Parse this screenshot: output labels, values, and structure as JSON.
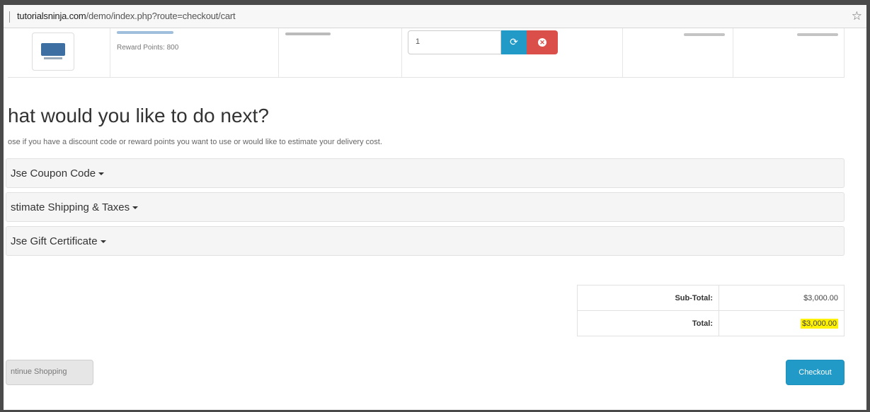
{
  "browser": {
    "url_host": "tutorialsninja.com",
    "url_path": "/demo/index.php?route=checkout/cart",
    "bookmark_icon": "star-icon"
  },
  "cart_row": {
    "reward_points": "Reward Points: 800",
    "quantity": "1",
    "update_icon": "refresh-icon",
    "remove_icon": "remove-icon"
  },
  "next": {
    "heading": "hat would you like to do next?",
    "subtext": "ose if you have a discount code or reward points you want to use or would like to estimate your delivery cost."
  },
  "panels": [
    {
      "label": "Jse Coupon Code"
    },
    {
      "label": "stimate Shipping & Taxes"
    },
    {
      "label": "Jse Gift Certificate"
    }
  ],
  "totals": {
    "subtotal_label": "Sub-Total:",
    "subtotal_value": "$3,000.00",
    "total_label": "Total:",
    "total_value": "$3,000.00",
    "highlight_color": "#fff200"
  },
  "buttons": {
    "continue": "ntinue Shopping",
    "checkout": "Checkout"
  },
  "colors": {
    "primary": "#229ac8",
    "danger": "#da4f49"
  }
}
